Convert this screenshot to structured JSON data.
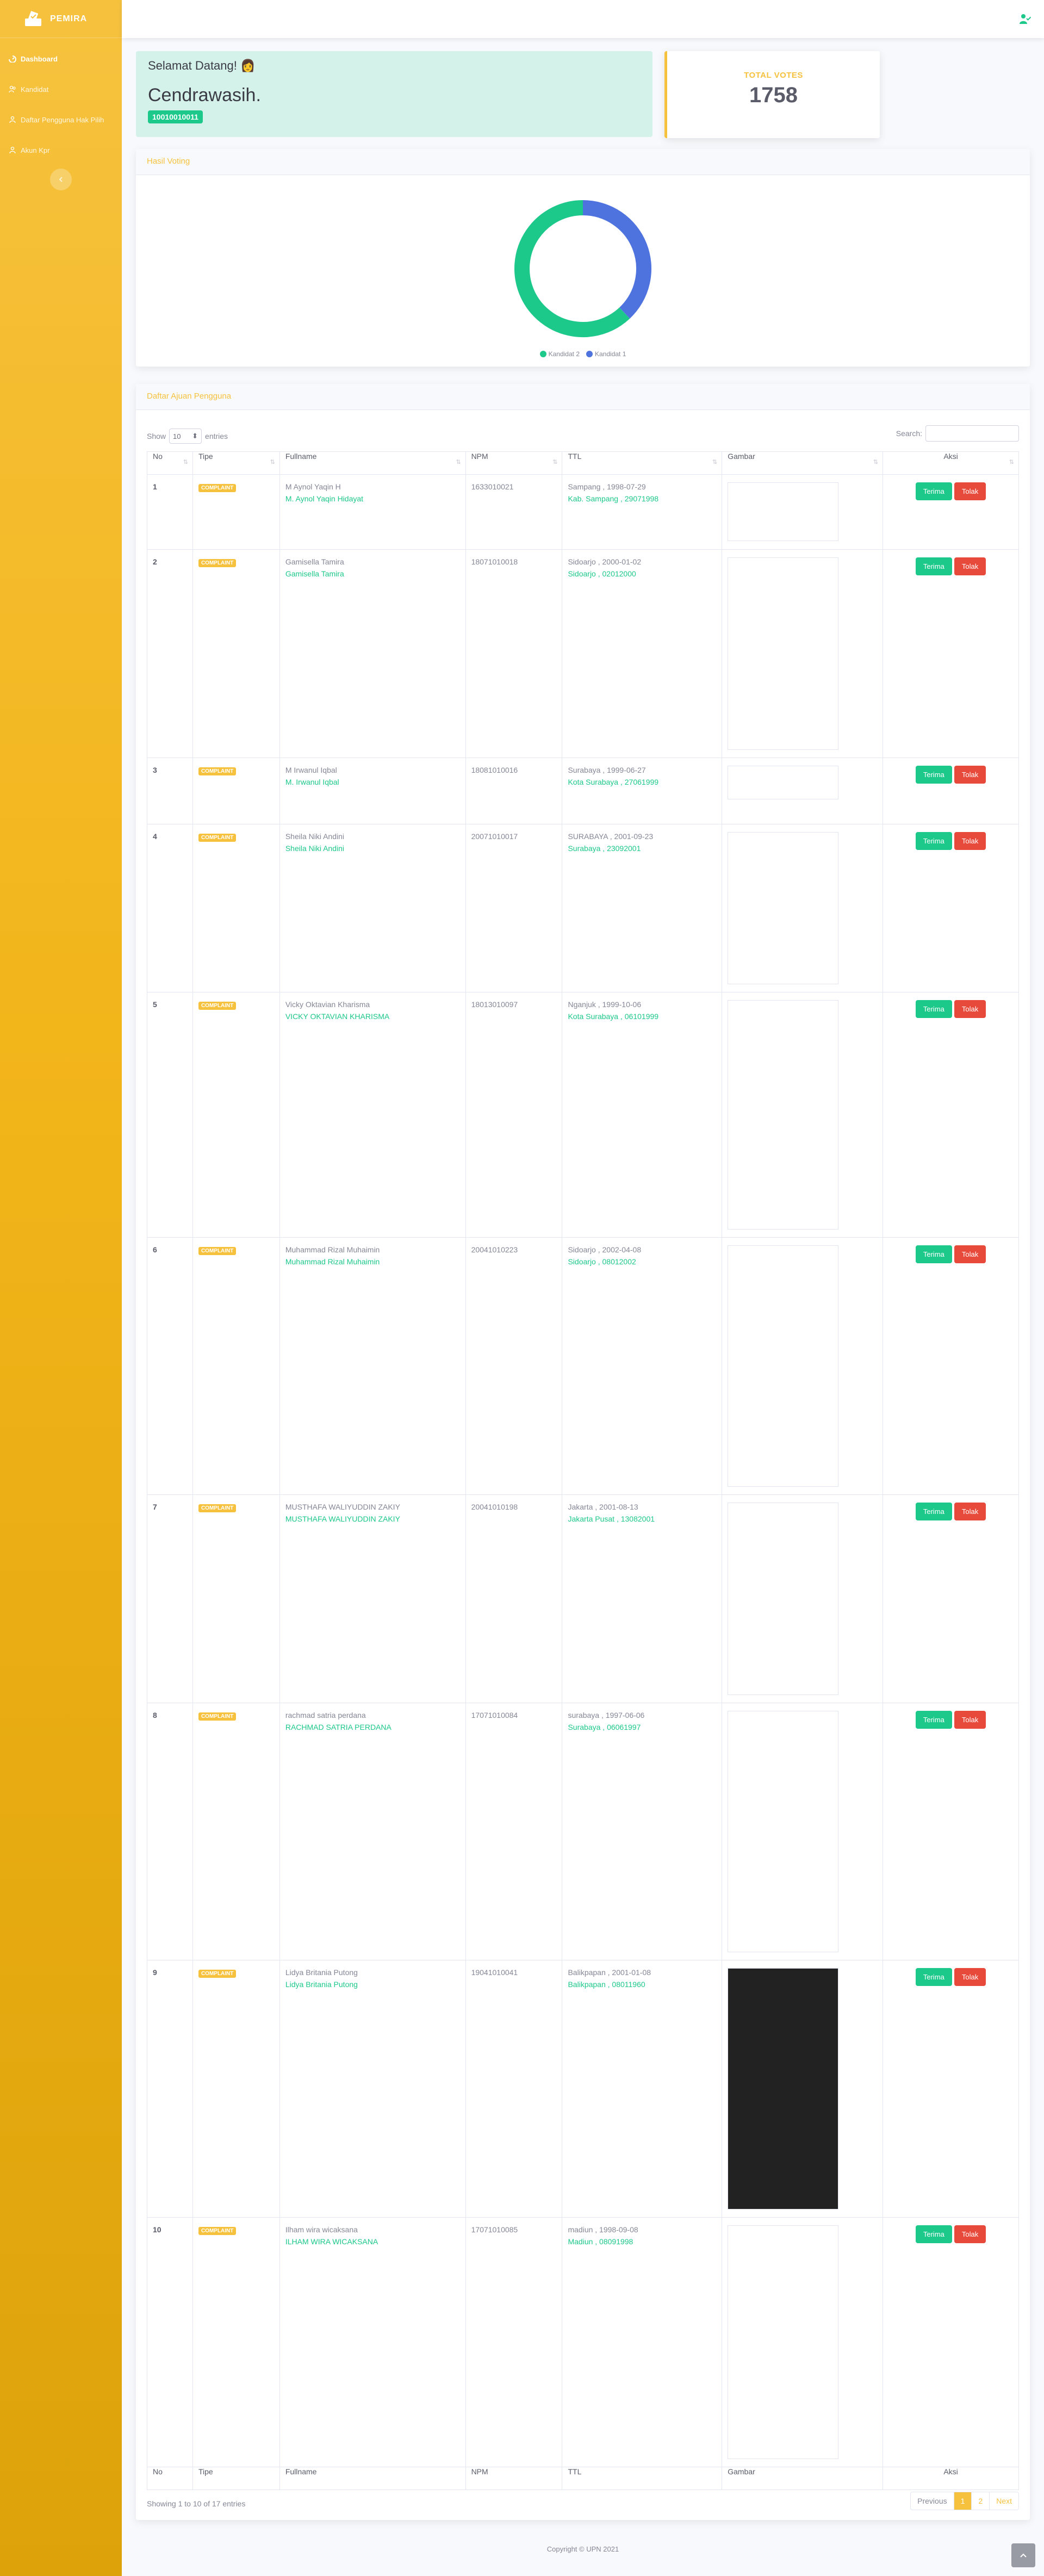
{
  "brand": {
    "name": "PEMIRA",
    "logo_icon": "vote-ballot-icon"
  },
  "sidebar": {
    "items": [
      {
        "label": "Dashboard",
        "icon": "dashboard-icon",
        "active": true
      },
      {
        "label": "Kandidat",
        "icon": "users-icon"
      },
      {
        "label": "Daftar Pengguna Hak Pilih",
        "icon": "user-list-icon"
      },
      {
        "label": "Akun Kpr",
        "icon": "user-icon"
      }
    ],
    "toggle_icon": "chevron-left-icon"
  },
  "topbar": {
    "user_icon": "user-check-icon"
  },
  "welcome": {
    "greeting": "Selamat Datang! 👩",
    "name": "Cendrawasih.",
    "id": "10010010011"
  },
  "votes": {
    "label": "TOTAL VOTES",
    "value": "1758"
  },
  "voting_card": {
    "title": "Hasil Voting"
  },
  "chart_data": {
    "type": "pie",
    "donut": true,
    "categories": [
      "Kandidat 2",
      "Kandidat 1"
    ],
    "values": [
      62,
      38
    ],
    "colors": [
      "#1cc88a",
      "#4e73df"
    ],
    "legend_position": "bottom"
  },
  "table_card": {
    "title": "Daftar Ajuan Pengguna",
    "show_label": "Show",
    "show_value": "10",
    "entries_label": "entries",
    "search_label": "Search:",
    "columns": [
      "No",
      "Tipe",
      "Fullname",
      "NPM",
      "TTL",
      "Gambar",
      "Aksi"
    ],
    "accept_label": "Terima",
    "reject_label": "Tolak",
    "rows": [
      {
        "no": "1",
        "type": "COMPLAINT",
        "fullname": "M Aynol Yaqin H",
        "fullname_ref": "M. Aynol Yaqin Hidayat",
        "npm": "1633010021",
        "ttl": "Sampang , 1998-07-29",
        "ttl_ref": "Kab. Sampang , 29071998"
      },
      {
        "no": "2",
        "type": "COMPLAINT",
        "fullname": "Gamisella Tamira",
        "fullname_ref": "Gamisella Tamira",
        "npm": "18071010018",
        "ttl": "Sidoarjo , 2000-01-02",
        "ttl_ref": "Sidoarjo , 02012000"
      },
      {
        "no": "3",
        "type": "COMPLAINT",
        "fullname": "M Irwanul Iqbal",
        "fullname_ref": "M. Irwanul Iqbal",
        "npm": "18081010016",
        "ttl": "Surabaya , 1999-06-27",
        "ttl_ref": "Kota Surabaya , 27061999"
      },
      {
        "no": "4",
        "type": "COMPLAINT",
        "fullname": "Sheila Niki Andini",
        "fullname_ref": "Sheila Niki Andini",
        "npm": "20071010017",
        "ttl": "SURABAYA , 2001-09-23",
        "ttl_ref": "Surabaya , 23092001"
      },
      {
        "no": "5",
        "type": "COMPLAINT",
        "fullname": "Vicky Oktavian Kharisma",
        "fullname_ref": "VICKY OKTAVIAN KHARISMA",
        "npm": "18013010097",
        "ttl": "Nganjuk , 1999-10-06",
        "ttl_ref": "Kota Surabaya , 06101999"
      },
      {
        "no": "6",
        "type": "COMPLAINT",
        "fullname": "Muhammad Rizal Muhaimin",
        "fullname_ref": "Muhammad Rizal Muhaimin",
        "npm": "20041010223",
        "ttl": "Sidoarjo , 2002-04-08",
        "ttl_ref": "Sidoarjo , 08012002"
      },
      {
        "no": "7",
        "type": "COMPLAINT",
        "fullname": "MUSTHAFA WALIYUDDIN ZAKIY",
        "fullname_ref": "MUSTHAFA WALIYUDDIN ZAKIY",
        "npm": "20041010198",
        "ttl": "Jakarta , 2001-08-13",
        "ttl_ref": "Jakarta Pusat , 13082001"
      },
      {
        "no": "8",
        "type": "COMPLAINT",
        "fullname": "rachmad satria perdana",
        "fullname_ref": "RACHMAD SATRIA PERDANA",
        "npm": "17071010084",
        "ttl": "surabaya , 1997-06-06",
        "ttl_ref": "Surabaya , 06061997"
      },
      {
        "no": "9",
        "type": "COMPLAINT",
        "fullname": "Lidya Britania Putong",
        "fullname_ref": "Lidya Britania Putong",
        "npm": "19041010041",
        "ttl": "Balikpapan , 2001-01-08",
        "ttl_ref": "Balikpapan , 08011960"
      },
      {
        "no": "10",
        "type": "COMPLAINT",
        "fullname": "Ilham wira wicaksana",
        "fullname_ref": "ILHAM WIRA WICAKSANA",
        "npm": "17071010085",
        "ttl": "madiun , 1998-09-08",
        "ttl_ref": "Madiun , 08091998"
      }
    ],
    "info": "Showing 1 to 10 of 17 entries",
    "pagination": {
      "previous": "Previous",
      "pages": [
        "1",
        "2"
      ],
      "next": "Next"
    }
  },
  "footer": {
    "text": "Copyright © UPN 2021"
  },
  "colors": {
    "primary": "#f6c23e",
    "success": "#1cc88a",
    "danger": "#e74a3b",
    "blue": "#4e73df"
  }
}
